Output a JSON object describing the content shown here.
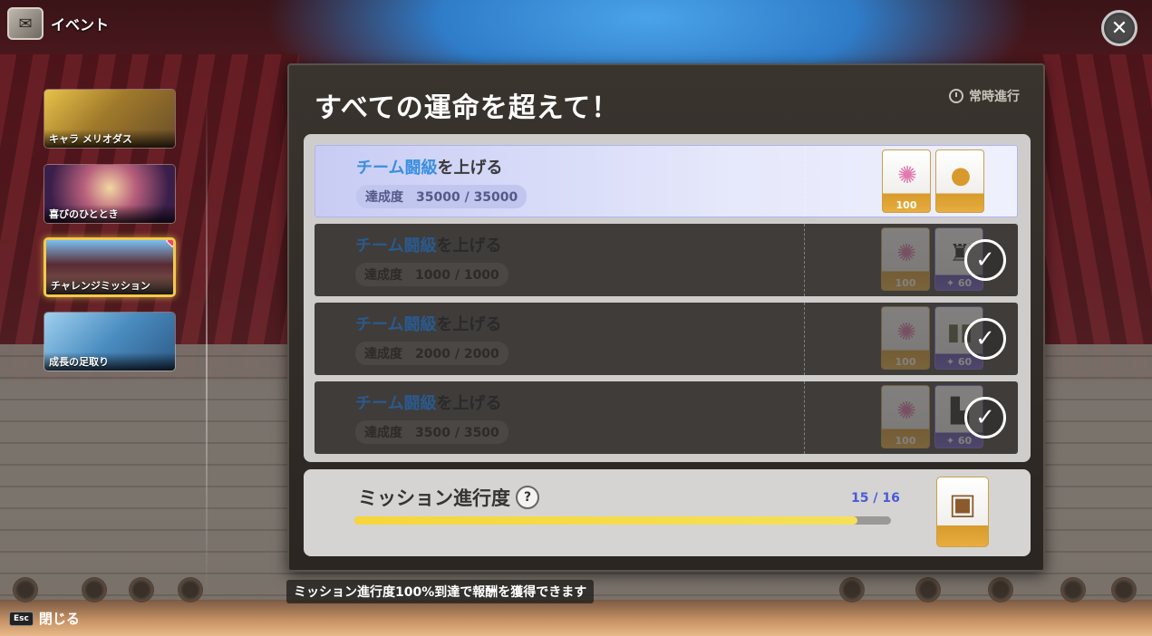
{
  "header": {
    "title": "イベント",
    "icon": "event-icon"
  },
  "close_icon": "close-icon",
  "sidebar": {
    "items": [
      {
        "label": "キャラ メリオダス",
        "active": false,
        "thumb_color": "#c8a23a"
      },
      {
        "label": "喜びのひととき",
        "active": false,
        "thumb_color": "#7a3d8c"
      },
      {
        "label": "チャレンジミッション",
        "active": true,
        "thumb_color": "#4a89c8"
      },
      {
        "label": "成長の足取り",
        "active": false,
        "thumb_color": "#5aa0c8"
      }
    ]
  },
  "panel": {
    "title": "すべての運命を超えて！",
    "status": "常時進行"
  },
  "missions": [
    {
      "title_hl": "チーム闘級",
      "title_rest": "を上げる",
      "progress_label": "達成度",
      "progress": "35000 / 35000",
      "state": "claimable",
      "rewards": [
        {
          "icon": "star-orb-icon",
          "qty": "100",
          "style": "gold"
        },
        {
          "icon": "gold-medal-icon",
          "qty": "",
          "style": "gold"
        }
      ]
    },
    {
      "title_hl": "チーム闘級",
      "title_rest": "を上げる",
      "progress_label": "達成度",
      "progress": "1000 / 1000",
      "state": "done",
      "rewards": [
        {
          "icon": "star-orb-icon",
          "qty": "100",
          "style": "gold"
        },
        {
          "icon": "jacket-icon",
          "qty": "✦ 60",
          "style": "purple"
        }
      ]
    },
    {
      "title_hl": "チーム闘級",
      "title_rest": "を上げる",
      "progress_label": "達成度",
      "progress": "2000 / 2000",
      "state": "done",
      "rewards": [
        {
          "icon": "star-orb-icon",
          "qty": "100",
          "style": "gold"
        },
        {
          "icon": "pants-icon",
          "qty": "✦ 60",
          "style": "purple"
        }
      ]
    },
    {
      "title_hl": "チーム闘級",
      "title_rest": "を上げる",
      "progress_label": "達成度",
      "progress": "3500 / 3500",
      "state": "done",
      "rewards": [
        {
          "icon": "star-orb-icon",
          "qty": "100",
          "style": "gold"
        },
        {
          "icon": "boots-icon",
          "qty": "✦ 60",
          "style": "purple"
        }
      ]
    }
  ],
  "mission_progress": {
    "title": "ミッション進行度",
    "help": "?",
    "count": "15 / 16",
    "fraction": 0.9375,
    "reward_icon": "treasure-chest-icon"
  },
  "hint": "ミッション進行度100%到達で報酬を獲得できます",
  "footer": {
    "key": "Esc",
    "label": "閉じる"
  },
  "colors": {
    "accent_blue": "#3b8fe0",
    "progress_yellow": "#f7d63a",
    "active_border": "#f2c94c"
  }
}
